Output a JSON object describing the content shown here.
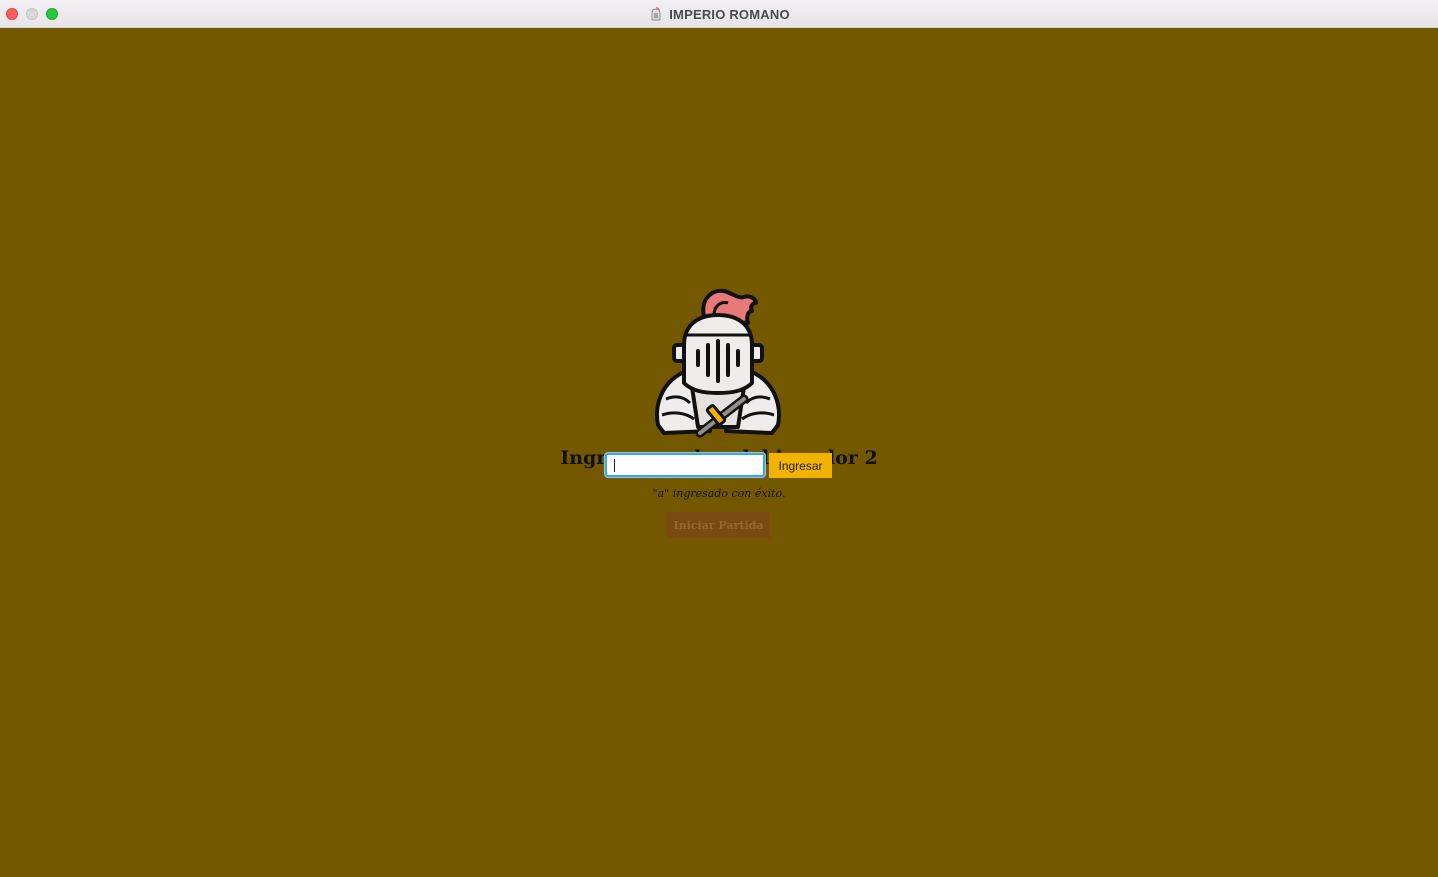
{
  "window": {
    "title": "IMPERIO ROMANO",
    "title_icon": "knight-helmet-icon",
    "traffic_lights": [
      "close",
      "minimize",
      "maximize"
    ]
  },
  "main": {
    "avatar_icon": "knight-icon",
    "heading": "Ingrese nombre del jugador 2",
    "name_input": {
      "value": "",
      "placeholder": ""
    },
    "submit_label": "Ingresar",
    "status_message": "\"a\" ingresado con éxito.",
    "start_label": "Iniciar Partida"
  },
  "colors": {
    "background": "#735800",
    "submit_button": "#f2b300",
    "start_button": "#7a4a14",
    "input_focus": "#3ea6d8",
    "plume": "#e8787a"
  }
}
